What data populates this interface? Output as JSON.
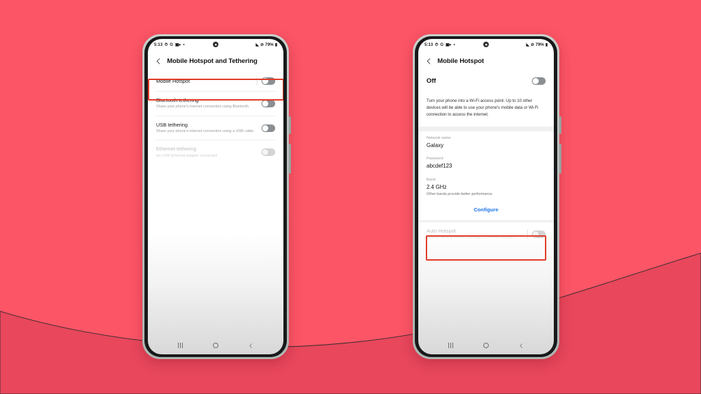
{
  "background": {
    "base_color": "#fb5566",
    "wave_color": "#e8475c"
  },
  "highlight_color": "#e03a26",
  "accent_color": "#1a73e8",
  "statusbar": {
    "time": "5:13",
    "left_icons": [
      "alarm-icon",
      "g-icon",
      "camera-icon",
      "dot-icon"
    ],
    "right_icons": [
      "wifi-icon",
      "mute-icon"
    ],
    "battery": "79%",
    "battery_icon": "battery-icon"
  },
  "phone1": {
    "header": {
      "back_icon": "back-chevron-icon",
      "title": "Mobile Hotspot and Tethering"
    },
    "rows": [
      {
        "title": "Mobile Hotspot",
        "sub": "",
        "toggle": "off",
        "dim": false,
        "highlighted": true
      },
      {
        "title": "Bluetooth tethering",
        "sub": "Share your phone's internet connection using Bluetooth.",
        "toggle": "off",
        "dim": false,
        "highlighted": false
      },
      {
        "title": "USB tethering",
        "sub": "Share your phone's internet connection using a USB cable.",
        "toggle": "off",
        "dim": false,
        "highlighted": false
      },
      {
        "title": "Ethernet tethering",
        "sub": "No USB Ethernet adapter connected",
        "toggle": "off-faded",
        "dim": true,
        "highlighted": false
      }
    ]
  },
  "phone2": {
    "header": {
      "back_icon": "back-chevron-icon",
      "title": "Mobile Hotspot"
    },
    "master": {
      "label": "Off",
      "toggle": "off"
    },
    "description": "Turn your phone into a Wi-Fi access point. Up to 10 other devices will be able to use your phone's mobile data or Wi-Fi connection to access the internet.",
    "fields": [
      {
        "label": "Network name",
        "value": "Galaxy",
        "note": ""
      },
      {
        "label": "Password",
        "value": "abcdef123",
        "note": ""
      },
      {
        "label": "Band",
        "value": "2.4 GHz",
        "note": "Other bands provide better performance."
      }
    ],
    "configure_label": "Configure",
    "auto_hotspot": {
      "title": "Auto Hotspot",
      "sub": "Turn on Nearby device scanning to use Auto Hotspot.",
      "toggle": "off-faded"
    }
  },
  "navbar": {
    "recents": "recents-icon",
    "home": "home-icon",
    "back": "back-icon"
  }
}
